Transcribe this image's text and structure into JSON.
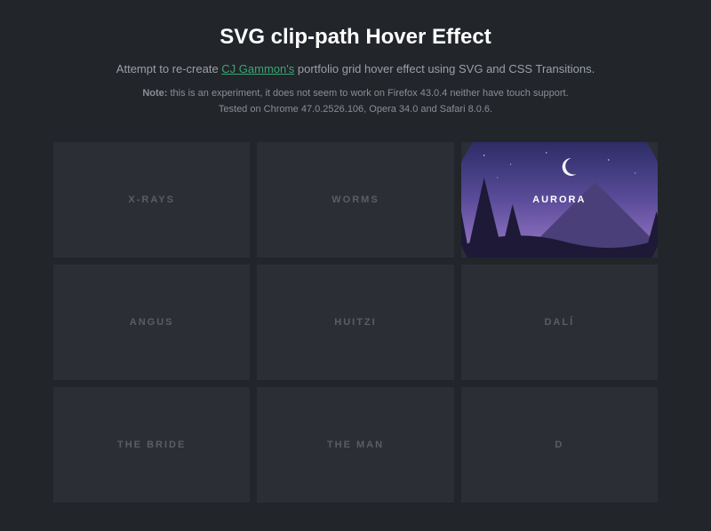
{
  "header": {
    "title": "SVG clip-path Hover Effect",
    "subtitle_before": "Attempt to re-create ",
    "subtitle_link": "CJ Gammon's",
    "subtitle_after": " portfolio grid hover effect using SVG and CSS Transitions.",
    "note_label": "Note:",
    "note_line1": " this is an experiment, it does not seem to work on Firefox 43.0.4 neither have touch support.",
    "note_line2": "Tested on Chrome 47.0.2526.106, Opera 34.0 and Safari 8.0.6."
  },
  "grid": {
    "items": [
      {
        "label": "X-RAYS"
      },
      {
        "label": "WORMS"
      },
      {
        "label": "AURORA"
      },
      {
        "label": "ANGUS"
      },
      {
        "label": "HUITZI"
      },
      {
        "label": "DALÍ"
      },
      {
        "label": "THE BRIDE"
      },
      {
        "label": "THE MAN"
      },
      {
        "label": "D"
      }
    ],
    "hover_index": 2
  },
  "colors": {
    "background": "#22252a",
    "card": "#2b2f35",
    "accent_link": "#3aa675"
  }
}
